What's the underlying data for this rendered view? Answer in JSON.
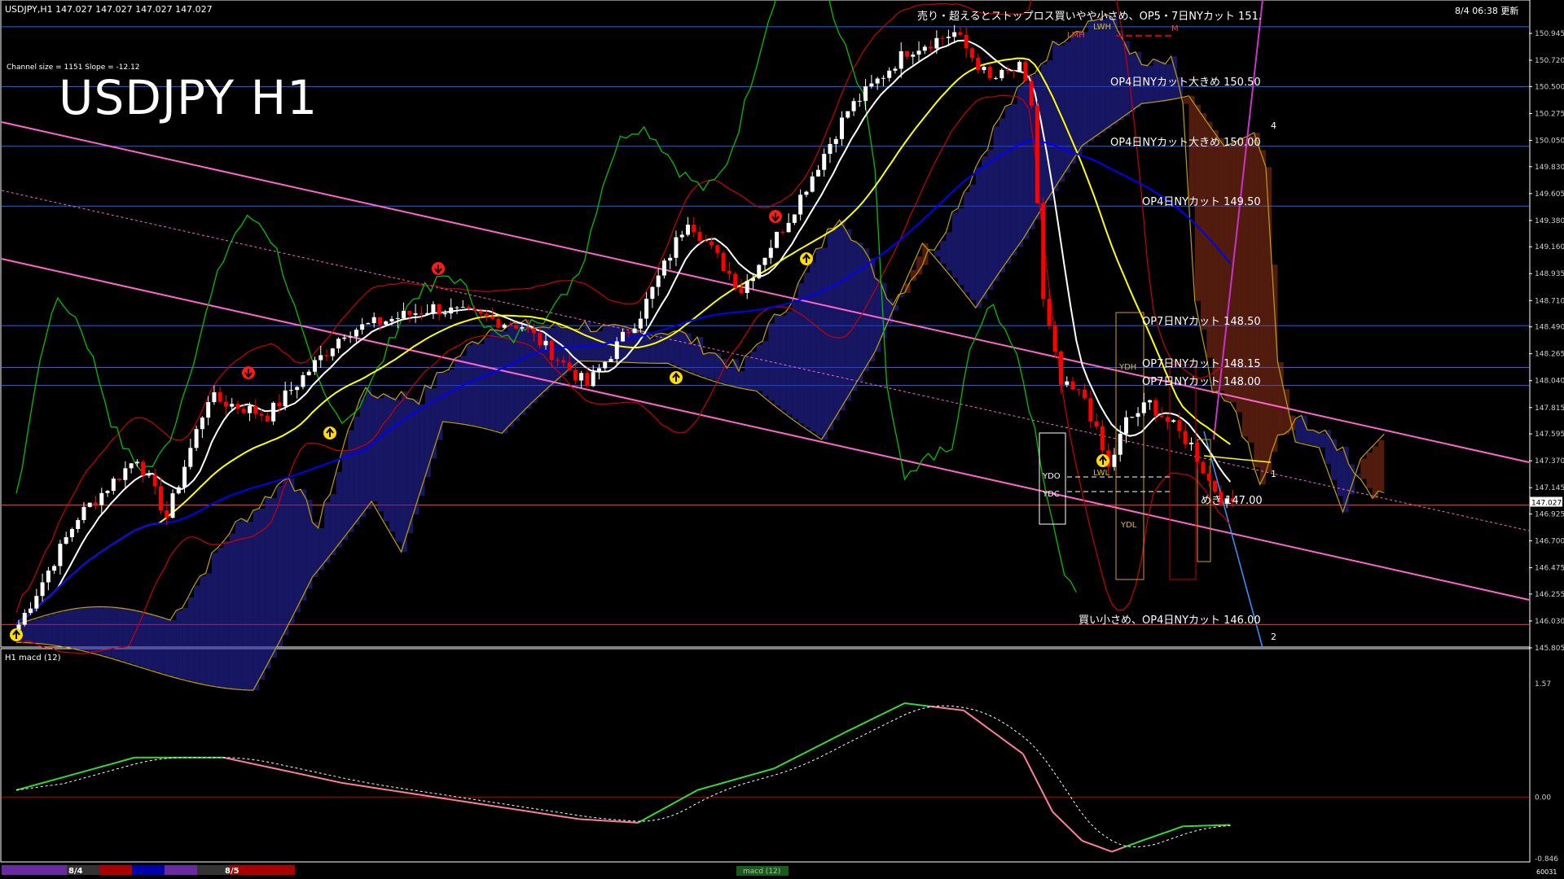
{
  "header": {
    "symbol_info": "USDJPY,H1  147.027 147.027 147.027 147.027",
    "updated": "8/4 06:38 更新",
    "channel_info": "Channel size = 1151 Slope = -12.12",
    "title": "USDJPY H1",
    "top_note": "売り・超えるとストップロス買いやや小さめ、OP5・7日NYカット 151."
  },
  "price_levels": [
    {
      "price": 150.5,
      "label": "OP4日NYカット大きめ 150.50"
    },
    {
      "price": 150.0,
      "label": "OP4日NYカット大きめ 150.00"
    },
    {
      "price": 149.5,
      "label": "OP4日NYカット 149.50"
    },
    {
      "price": 148.5,
      "label": "OP7日NYカット 148.50"
    },
    {
      "price": 148.15,
      "label": "OP7日NYカット 148.15"
    },
    {
      "price": 148.0,
      "label": "OP7日NYカット 148.00"
    },
    {
      "price": 147.0,
      "label": "めき 147.00"
    },
    {
      "price": 146.0,
      "label": "買い小さめ、OP4日NYカット 146.00"
    }
  ],
  "box_labels": [
    "LMH",
    "LWH",
    "M",
    "YDH",
    "YDO",
    "YDC",
    "LWL",
    "YDL"
  ],
  "channel_labels": [
    "4",
    "1",
    "2"
  ],
  "price_axis": [
    "150.945",
    "150.720",
    "150.500",
    "150.275",
    "150.050",
    "149.830",
    "149.605",
    "149.380",
    "149.160",
    "148.935",
    "148.710",
    "148.490",
    "148.265",
    "148.040",
    "147.815",
    "147.595",
    "147.370",
    "147.145",
    "146.925",
    "146.700",
    "146.475",
    "146.255",
    "146.030",
    "145.805"
  ],
  "current_price": "147.027",
  "macd": {
    "label": "H1  macd (12)",
    "axis": [
      "1.57",
      "0.00",
      "-0.846"
    ]
  },
  "bottom_bar": {
    "dates": [
      "8/4",
      "8/5"
    ],
    "tab_label": "macd (12)",
    "counter": "60031"
  },
  "colors": {
    "background": "#000000",
    "bull_candle": "#ffffff",
    "bear_candle": "#ff0000",
    "channel": "#ff66cc",
    "level_line": "#1e64ff",
    "ma_white": "#ffffff",
    "ma_yellow": "#ffff00",
    "ma_blue": "#0000ff",
    "chikou": "#00c000",
    "macd_line": "#33dd33",
    "macd_signal": "#ffffff"
  },
  "chart_data": {
    "type": "candlestick",
    "symbol": "USDJPY",
    "timeframe": "H1",
    "ylim": [
      145.8,
      151.1
    ],
    "last_price": 147.027,
    "close_path": [
      {
        "bar": 0,
        "close": 146.0
      },
      {
        "bar": 10,
        "close": 146.9
      },
      {
        "bar": 20,
        "close": 147.4
      },
      {
        "bar": 25,
        "close": 146.9
      },
      {
        "bar": 32,
        "close": 147.9
      },
      {
        "bar": 42,
        "close": 147.75
      },
      {
        "bar": 55,
        "close": 148.45
      },
      {
        "bar": 70,
        "close": 148.65
      },
      {
        "bar": 85,
        "close": 148.5
      },
      {
        "bar": 96,
        "close": 148.0
      },
      {
        "bar": 105,
        "close": 148.6
      },
      {
        "bar": 113,
        "close": 149.4
      },
      {
        "bar": 122,
        "close": 148.8
      },
      {
        "bar": 130,
        "close": 149.4
      },
      {
        "bar": 140,
        "close": 150.3
      },
      {
        "bar": 150,
        "close": 150.8
      },
      {
        "bar": 158,
        "close": 150.95
      },
      {
        "bar": 164,
        "close": 150.55
      },
      {
        "bar": 169,
        "close": 150.65
      },
      {
        "bar": 171,
        "close": 150.35
      },
      {
        "bar": 173,
        "close": 148.7
      },
      {
        "bar": 176,
        "close": 148.0
      },
      {
        "bar": 180,
        "close": 147.9
      },
      {
        "bar": 184,
        "close": 147.3
      },
      {
        "bar": 187,
        "close": 147.7
      },
      {
        "bar": 191,
        "close": 147.85
      },
      {
        "bar": 194,
        "close": 147.7
      },
      {
        "bar": 198,
        "close": 147.5
      },
      {
        "bar": 201,
        "close": 147.2
      },
      {
        "bar": 204,
        "close": 147.0
      },
      {
        "bar": 205,
        "close": 147.027
      }
    ],
    "macd_path": [
      {
        "bar": 0,
        "value": 0.1
      },
      {
        "bar": 20,
        "value": 0.55
      },
      {
        "bar": 35,
        "value": 0.55
      },
      {
        "bar": 55,
        "value": 0.2
      },
      {
        "bar": 75,
        "value": -0.05
      },
      {
        "bar": 95,
        "value": -0.3
      },
      {
        "bar": 105,
        "value": -0.35
      },
      {
        "bar": 115,
        "value": 0.1
      },
      {
        "bar": 128,
        "value": 0.4
      },
      {
        "bar": 140,
        "value": 0.9
      },
      {
        "bar": 150,
        "value": 1.3
      },
      {
        "bar": 160,
        "value": 1.2
      },
      {
        "bar": 170,
        "value": 0.6
      },
      {
        "bar": 175,
        "value": -0.2
      },
      {
        "bar": 180,
        "value": -0.6
      },
      {
        "bar": 185,
        "value": -0.75
      },
      {
        "bar": 190,
        "value": -0.6
      },
      {
        "bar": 197,
        "value": -0.4
      },
      {
        "bar": 205,
        "value": -0.38
      }
    ]
  }
}
